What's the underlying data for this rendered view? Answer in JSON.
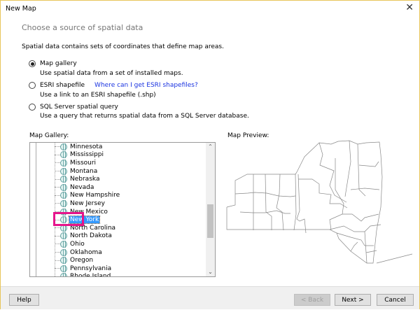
{
  "window": {
    "title": "New Map",
    "close": "✕"
  },
  "heading": "Choose a source of spatial data",
  "description": "Spatial data contains sets of coordinates that define map areas.",
  "options": [
    {
      "label": "Map gallery",
      "sub": "Use spatial data from a set of installed maps.",
      "selected": true
    },
    {
      "label": "ESRI shapefile",
      "link": "Where can I get ESRI shapefiles?",
      "sub": "Use a link to an ESRI shapefile (.shp)",
      "selected": false
    },
    {
      "label": "SQL Server spatial query",
      "sub": "Use a query that returns spatial data from a SQL Server database.",
      "selected": false
    }
  ],
  "gallery": {
    "label": "Map Gallery:",
    "items": [
      "Minnesota",
      "Mississippi",
      "Missouri",
      "Montana",
      "Nebraska",
      "Nevada",
      "New Hampshire",
      "New Jersey",
      "New Mexico",
      "New York",
      "North Carolina",
      "North Dakota",
      "Ohio",
      "Oklahoma",
      "Oregon",
      "Pennsylvania",
      "Rhode Island"
    ],
    "selected": "New York",
    "highlight_color": "#e6158c"
  },
  "preview": {
    "label": "Map Preview:"
  },
  "footer": {
    "help": "Help",
    "back": "< Back",
    "next": "Next >",
    "cancel": "Cancel"
  }
}
